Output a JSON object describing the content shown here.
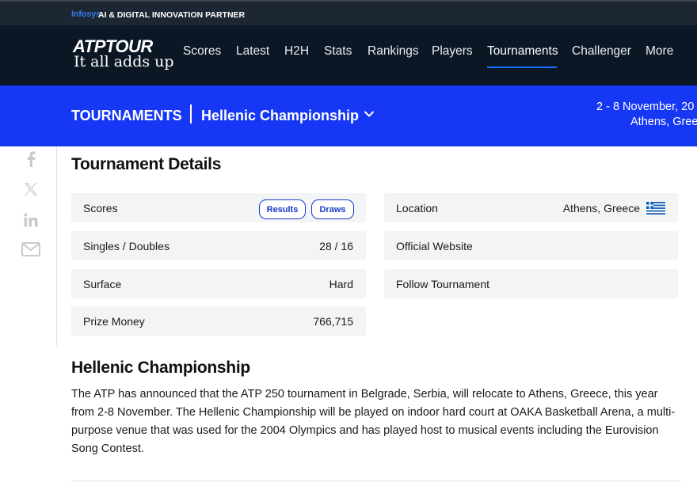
{
  "partner": {
    "brand": "Infosys",
    "text": "AI & DIGITAL INNOVATION PARTNER"
  },
  "nav": {
    "logo": "ATPTOUR",
    "tagline": "It all adds up",
    "items": [
      {
        "label": "Scores"
      },
      {
        "label": "Latest"
      },
      {
        "label": "H2H"
      },
      {
        "label": "Stats"
      },
      {
        "label": "Rankings"
      },
      {
        "label": "Players"
      },
      {
        "label": "Tournaments",
        "active": true
      },
      {
        "label": "Challenger"
      },
      {
        "label": "More"
      }
    ]
  },
  "banner": {
    "section": "TOURNAMENTS",
    "tournament": "Hellenic Championship",
    "dates": "2 - 8 November, 20",
    "location": "Athens, Gree"
  },
  "share": {
    "icons": [
      "facebook-icon",
      "x-icon",
      "linkedin-icon",
      "email-icon"
    ]
  },
  "details": {
    "title": "Tournament Details",
    "scores_label": "Scores",
    "results_label": "Results",
    "draws_label": "Draws",
    "draw_label": "Singles / Doubles",
    "draw_value": "28 / 16",
    "surface_label": "Surface",
    "surface_value": "Hard",
    "prize_label": "Prize Money",
    "prize_value": "766,715",
    "location_label": "Location",
    "location_value": "Athens, Greece",
    "website_label": "Official Website",
    "follow_label": "Follow Tournament"
  },
  "about": {
    "title": "Hellenic Championship",
    "body": "The ATP has announced that the ATP 250 tournament in Belgrade, Serbia, will relocate to Athens, Greece, this year from 2-8 November. The Hellenic Championship will be played on indoor hard court at OAKA Basketball Arena, a multi-purpose venue that was used for the 2004 Olympics and has played host to musical events including the Eurovision Song Contest."
  },
  "colors": {
    "nav_bg": "#0c1725",
    "partner_bg": "#1d2734",
    "banner_bg": "#1638f5",
    "accent": "#1638c8",
    "card_bg": "#f3f4f6"
  }
}
